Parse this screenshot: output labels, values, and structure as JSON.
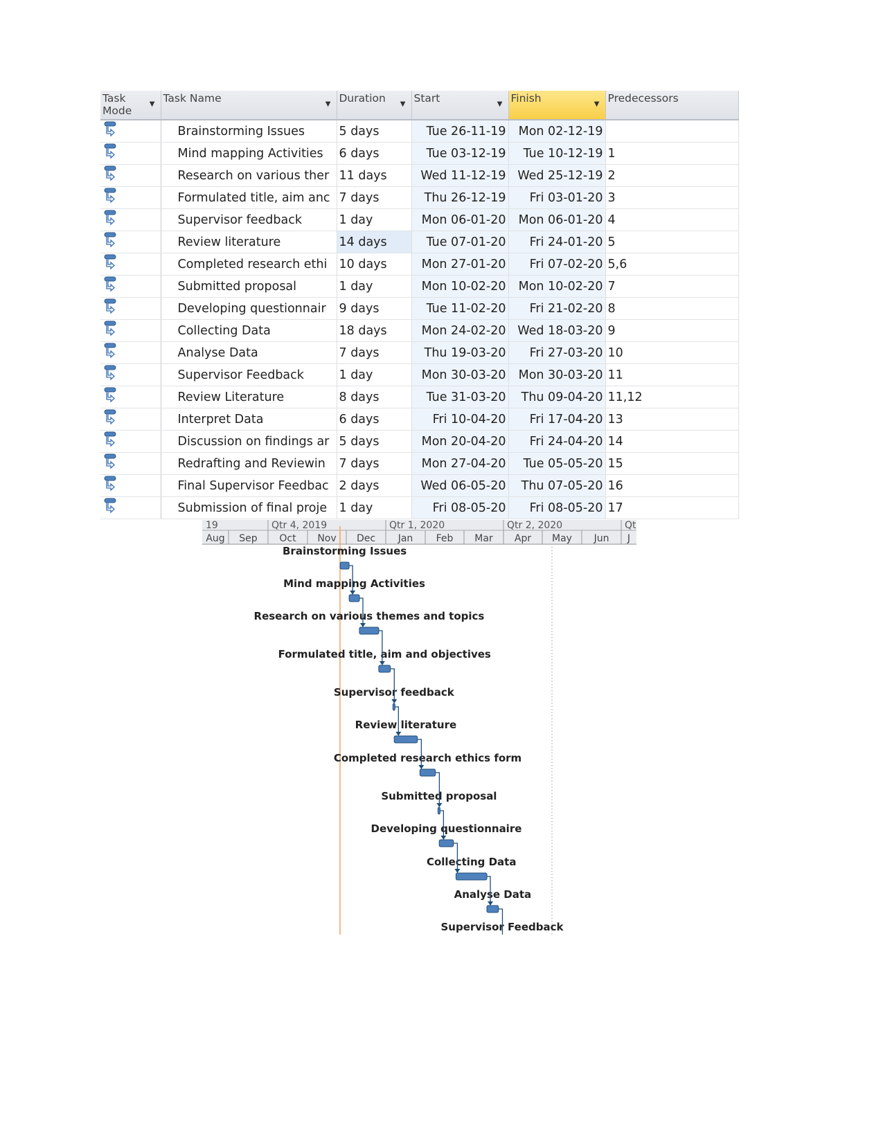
{
  "table": {
    "columns": [
      {
        "label": "Task Mode",
        "line1": "Task",
        "line2": "Mode"
      },
      {
        "label": "Task Name"
      },
      {
        "label": "Duration"
      },
      {
        "label": "Start"
      },
      {
        "label": "Finish"
      },
      {
        "label": "Predecessors"
      }
    ],
    "mode_icon": "auto-scheduled-task-icon",
    "rows": [
      {
        "name": "Brainstorming Issues",
        "duration": "5 days",
        "start": "Tue 26-11-19",
        "finish": "Mon 02-12-19",
        "pred": ""
      },
      {
        "name": "Mind mapping Activities",
        "duration": "6 days",
        "start": "Tue 03-12-19",
        "finish": "Tue 10-12-19",
        "pred": "1"
      },
      {
        "name": "Research on various ther",
        "duration": "11 days",
        "start": "Wed 11-12-19",
        "finish": "Wed 25-12-19",
        "pred": "2"
      },
      {
        "name": "Formulated title, aim anc",
        "duration": "7 days",
        "start": "Thu 26-12-19",
        "finish": "Fri 03-01-20",
        "pred": "3"
      },
      {
        "name": "Supervisor feedback",
        "duration": "1 day",
        "start": "Mon 06-01-20",
        "finish": "Mon 06-01-20",
        "pred": "4"
      },
      {
        "name": "Review literature",
        "duration": "14 days",
        "start": "Tue 07-01-20",
        "finish": "Fri 24-01-20",
        "pred": "5"
      },
      {
        "name": "Completed research ethi",
        "duration": "10 days",
        "start": "Mon 27-01-20",
        "finish": "Fri 07-02-20",
        "pred": "5,6"
      },
      {
        "name": "Submitted proposal",
        "duration": "1 day",
        "start": "Mon 10-02-20",
        "finish": "Mon 10-02-20",
        "pred": "7"
      },
      {
        "name": "Developing questionnair",
        "duration": "9 days",
        "start": "Tue 11-02-20",
        "finish": "Fri 21-02-20",
        "pred": "8"
      },
      {
        "name": "Collecting Data",
        "duration": "18 days",
        "start": "Mon 24-02-20",
        "finish": "Wed 18-03-20",
        "pred": "9"
      },
      {
        "name": "Analyse Data",
        "duration": "7 days",
        "start": "Thu 19-03-20",
        "finish": "Fri 27-03-20",
        "pred": "10"
      },
      {
        "name": "Supervisor Feedback",
        "duration": "1 day",
        "start": "Mon 30-03-20",
        "finish": "Mon 30-03-20",
        "pred": "11"
      },
      {
        "name": "Review Literature",
        "duration": "8 days",
        "start": "Tue 31-03-20",
        "finish": "Thu 09-04-20",
        "pred": "11,12"
      },
      {
        "name": "Interpret Data",
        "duration": "6 days",
        "start": "Fri 10-04-20",
        "finish": "Fri 17-04-20",
        "pred": "13"
      },
      {
        "name": "Discussion on findings ar",
        "duration": "5 days",
        "start": "Mon 20-04-20",
        "finish": "Fri 24-04-20",
        "pred": "14"
      },
      {
        "name": "Redrafting and Reviewin",
        "duration": "7 days",
        "start": "Mon 27-04-20",
        "finish": "Tue 05-05-20",
        "pred": "15"
      },
      {
        "name": "Final Supervisor Feedbac",
        "duration": "2 days",
        "start": "Wed 06-05-20",
        "finish": "Thu 07-05-20",
        "pred": "16"
      },
      {
        "name": "Submission of final proje",
        "duration": "1 day",
        "start": "Fri 08-05-20",
        "finish": "Fri 08-05-20",
        "pred": "17"
      }
    ]
  },
  "gantt": {
    "quarters": [
      "19",
      "Qtr 4, 2019",
      "Qtr 1, 2020",
      "Qtr 2, 2020",
      "Qt"
    ],
    "months": [
      "Aug",
      "Sep",
      "Oct",
      "Nov",
      "Dec",
      "Jan",
      "Feb",
      "Mar",
      "Apr",
      "May",
      "Jun",
      "J"
    ],
    "bar_color": "#4f81bd",
    "today_line_color": "#f4a460",
    "tasks": [
      {
        "label": "Brainstorming Issues",
        "start": "26-11-19",
        "finish": "02-12-19"
      },
      {
        "label": "Mind mapping Activities",
        "start": "03-12-19",
        "finish": "10-12-19"
      },
      {
        "label": "Research on various themes and topics",
        "start": "11-12-19",
        "finish": "25-12-19"
      },
      {
        "label": "Formulated title, aim and objectives",
        "start": "26-12-19",
        "finish": "03-01-20"
      },
      {
        "label": "Supervisor feedback",
        "start": "06-01-20",
        "finish": "06-01-20"
      },
      {
        "label": "Review literature",
        "start": "07-01-20",
        "finish": "24-01-20"
      },
      {
        "label": "Completed research ethics form",
        "start": "27-01-20",
        "finish": "07-02-20"
      },
      {
        "label": "Submitted proposal",
        "start": "10-02-20",
        "finish": "10-02-20"
      },
      {
        "label": "Developing questionnaire",
        "start": "11-02-20",
        "finish": "21-02-20"
      },
      {
        "label": "Collecting Data",
        "start": "24-02-20",
        "finish": "18-03-20"
      },
      {
        "label": "Analyse Data",
        "start": "19-03-20",
        "finish": "27-03-20"
      },
      {
        "label": "Supervisor Feedback",
        "start": "30-03-20",
        "finish": "30-03-20"
      }
    ]
  }
}
